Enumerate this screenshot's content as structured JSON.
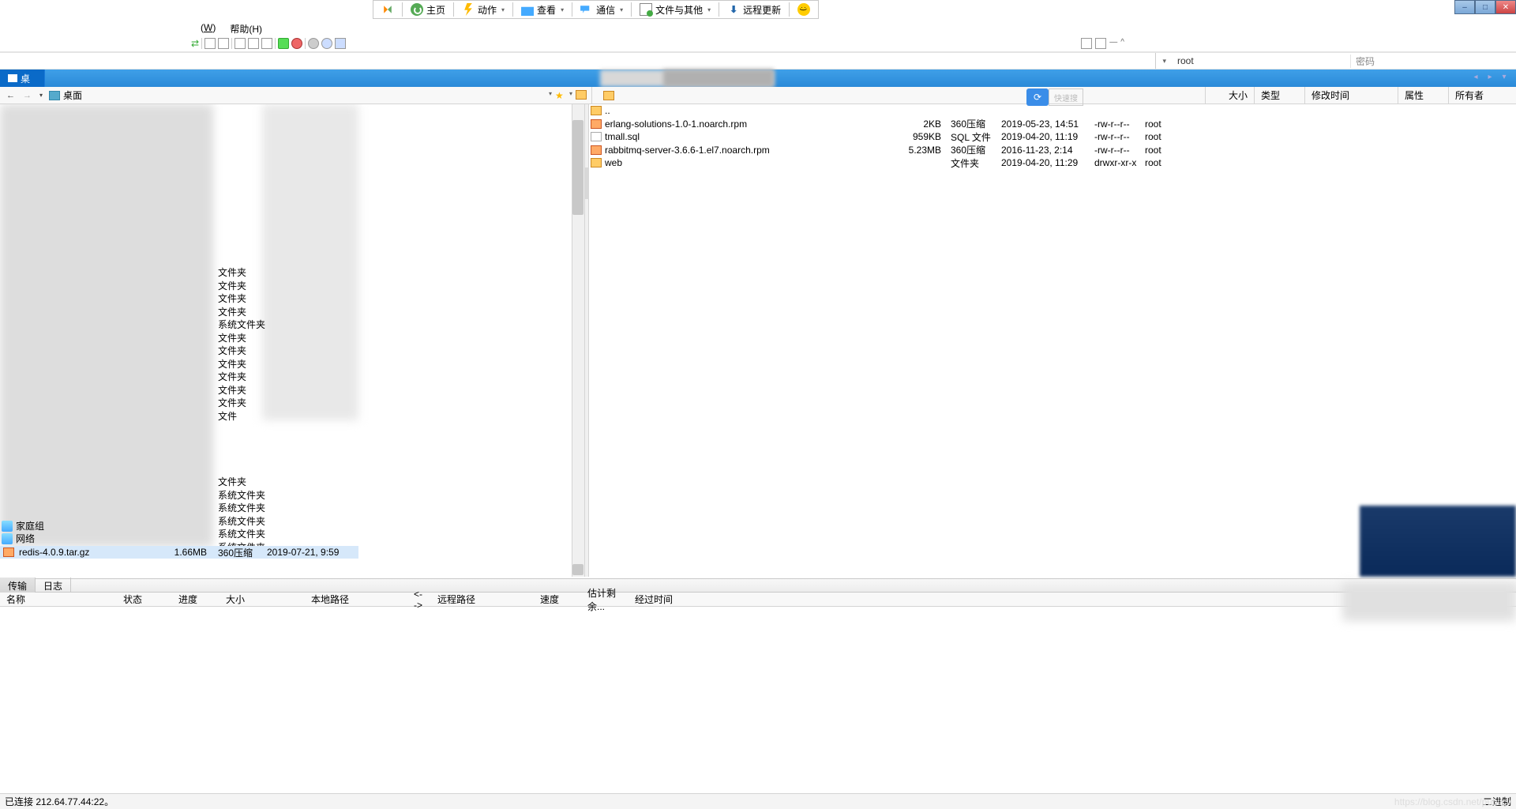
{
  "toolbar": {
    "home": "主页",
    "action": "动作",
    "view": "查看",
    "comm": "通信",
    "files": "文件与其他",
    "update": "远程更新"
  },
  "menu": {
    "w": "W",
    "help": "帮助(H)"
  },
  "address": {
    "user": "root",
    "pass": "密码"
  },
  "tab": {
    "desktop_label": "桌"
  },
  "nav": {
    "desktop": "桌面",
    "cols": {
      "size": "大小",
      "type": "类型",
      "mod": "修改时间",
      "attr": "属性",
      "owner": "所有者"
    },
    "refresh_side": "快速搜"
  },
  "local": {
    "types_top": [
      "文件夹",
      "文件夹",
      "文件夹",
      "文件夹",
      "系统文件夹",
      "文件夹",
      "文件夹",
      "文件夹",
      "文件夹",
      "文件夹",
      "文件夹",
      "文件"
    ],
    "types_bot": [
      "文件夹",
      "系统文件夹",
      "系统文件夹",
      "系统文件夹",
      "系统文件夹",
      "系统文件夹"
    ],
    "sidebar": {
      "homegroup": "家庭组",
      "network": "网络"
    },
    "selected": {
      "name": "redis-4.0.9.tar.gz",
      "size": "1.66MB",
      "type": "360压缩",
      "date": "2019-07-21, 9:59"
    }
  },
  "remote": {
    "rows": [
      {
        "icon": "up",
        "name": "..",
        "size": "",
        "type": "",
        "mod": "",
        "attr": "",
        "own": ""
      },
      {
        "icon": "arch",
        "name": "erlang-solutions-1.0-1.noarch.rpm",
        "size": "2KB",
        "type": "360压缩",
        "mod": "2019-05-23, 14:51",
        "attr": "-rw-r--r--",
        "own": "root"
      },
      {
        "icon": "sql",
        "name": "tmall.sql",
        "size": "959KB",
        "type": "SQL 文件",
        "mod": "2019-04-20, 11:19",
        "attr": "-rw-r--r--",
        "own": "root"
      },
      {
        "icon": "arch",
        "name": "rabbitmq-server-3.6.6-1.el7.noarch.rpm",
        "size": "5.23MB",
        "type": "360压缩",
        "mod": "2016-11-23, 2:14",
        "attr": "-rw-r--r--",
        "own": "root"
      },
      {
        "icon": "fold",
        "name": "web",
        "size": "",
        "type": "文件夹",
        "mod": "2019-04-20, 11:29",
        "attr": "drwxr-xr-x",
        "own": "root"
      }
    ]
  },
  "bottom_tabs": {
    "transfer": "传输",
    "log": "日志"
  },
  "transfer_cols": {
    "name": "名称",
    "status": "状态",
    "progress": "进度",
    "size": "大小",
    "local_path": "本地路径",
    "arrow": "<-->",
    "remote_path": "远程路径",
    "speed": "速度",
    "est": "估计剩余...",
    "elapsed": "经过时间"
  },
  "status": {
    "connected": "已连接 212.64.77.44:22。",
    "encoding": "二进制"
  },
  "watermark": "https://blog.csdn.net/publicv"
}
